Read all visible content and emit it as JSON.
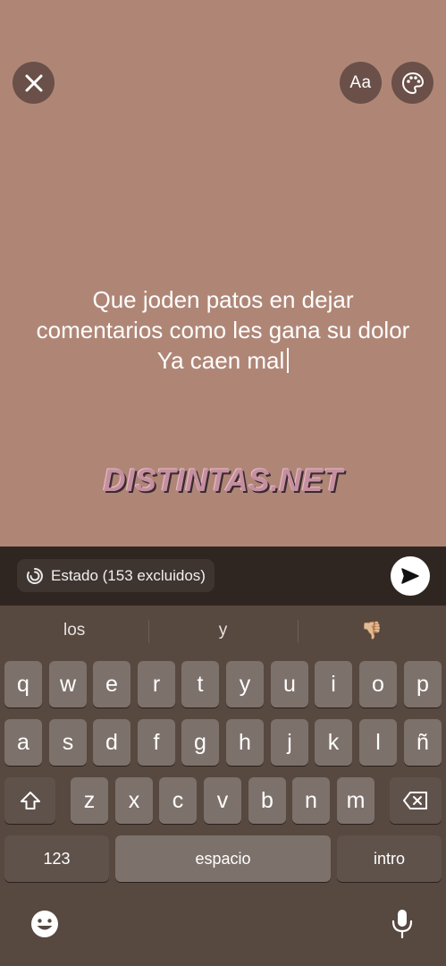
{
  "top_bar": {
    "font_label": "Aa"
  },
  "status": {
    "lines": [
      "Que joden patos en dejar",
      "comentarios como les gana su dolor",
      "Ya caen mal"
    ]
  },
  "watermark": "DISTINTAS.NET",
  "compose": {
    "audience_label": "Estado (153 excluidos)"
  },
  "keyboard": {
    "suggestions": [
      "los",
      "y",
      "👎🏼"
    ],
    "row1": [
      "q",
      "w",
      "e",
      "r",
      "t",
      "y",
      "u",
      "i",
      "o",
      "p"
    ],
    "row2": [
      "a",
      "s",
      "d",
      "f",
      "g",
      "h",
      "j",
      "k",
      "l",
      "ñ"
    ],
    "row3": [
      "z",
      "x",
      "c",
      "v",
      "b",
      "n",
      "m"
    ],
    "numbers_label": "123",
    "space_label": "espacio",
    "return_label": "intro"
  },
  "colors": {
    "canvas_background": "#af8676",
    "keyboard_background": "#574840",
    "key_background": "#7d716b"
  }
}
